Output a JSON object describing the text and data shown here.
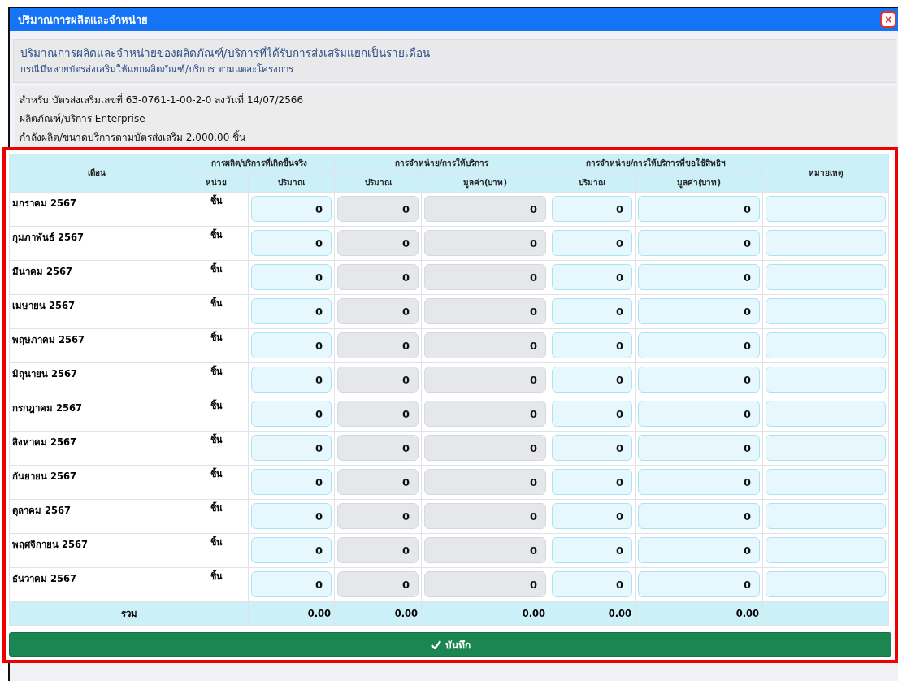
{
  "window": {
    "title": "ปริมาณการผลิตและจำหน่าย",
    "close": "×"
  },
  "intro": {
    "heading": "ปริมาณการผลิตและจำหน่ายของผลิตภัณฑ์/บริการที่ได้รับการส่งเสริมแยกเป็นรายเดือน",
    "note": "กรณีมีหลายบัตรส่งเสริมให้แยกผลิตภัณฑ์/บริการ ตามแต่ละโครงการ"
  },
  "info": [
    "สำหรับ บัตรส่งเสริมเลขที่ 63-0761-1-00-2-0 ลงวันที่ 14/07/2566",
    "ผลิตภัณฑ์/บริการ Enterprise",
    "กำลังผลิต/ขนาดบริการตามบัตรส่งเสริม 2,000.00 ชิ้น"
  ],
  "table": {
    "header_groups": [
      "เดือน",
      "การผลิต/บริการที่เกิดขึ้นจริง",
      "การจำหน่าย/การให้บริการ",
      "การจำหน่าย/การให้บริการที่ขอใช้สิทธิฯ",
      "หมายเหตุ"
    ],
    "sub_columns": [
      "หน่วย",
      "ปริมาณ",
      "ปริมาณ",
      "มูลค่า(บาท)",
      "ปริมาณ",
      "มูลค่า(บาท)"
    ],
    "input_columns": [
      {
        "disabled": false
      },
      {
        "disabled": true
      },
      {
        "disabled": true
      },
      {
        "disabled": false
      },
      {
        "disabled": false
      }
    ],
    "rows": [
      {
        "month": "มกราคม 2567",
        "unit": "ชิ้น",
        "values": [
          "0",
          "0",
          "0",
          "0",
          "0"
        ]
      },
      {
        "month": "กุมภาพันธ์ 2567",
        "unit": "ชิ้น",
        "values": [
          "0",
          "0",
          "0",
          "0",
          "0"
        ]
      },
      {
        "month": "มีนาคม 2567",
        "unit": "ชิ้น",
        "values": [
          "0",
          "0",
          "0",
          "0",
          "0"
        ]
      },
      {
        "month": "เมษายน 2567",
        "unit": "ชิ้น",
        "values": [
          "0",
          "0",
          "0",
          "0",
          "0"
        ]
      },
      {
        "month": "พฤษภาคม 2567",
        "unit": "ชิ้น",
        "values": [
          "0",
          "0",
          "0",
          "0",
          "0"
        ]
      },
      {
        "month": "มิถุนายน 2567",
        "unit": "ชิ้น",
        "values": [
          "0",
          "0",
          "0",
          "0",
          "0"
        ]
      },
      {
        "month": "กรกฎาคม 2567",
        "unit": "ชิ้น",
        "values": [
          "0",
          "0",
          "0",
          "0",
          "0"
        ]
      },
      {
        "month": "สิงหาคม 2567",
        "unit": "ชิ้น",
        "values": [
          "0",
          "0",
          "0",
          "0",
          "0"
        ]
      },
      {
        "month": "กันยายน 2567",
        "unit": "ชิ้น",
        "values": [
          "0",
          "0",
          "0",
          "0",
          "0"
        ]
      },
      {
        "month": "ตุลาคม 2567",
        "unit": "ชิ้น",
        "values": [
          "0",
          "0",
          "0",
          "0",
          "0"
        ]
      },
      {
        "month": "พฤศจิกายน 2567",
        "unit": "ชิ้น",
        "values": [
          "0",
          "0",
          "0",
          "0",
          "0"
        ]
      },
      {
        "month": "ธันวาคม 2567",
        "unit": "ชิ้น",
        "values": [
          "0",
          "0",
          "0",
          "0",
          "0"
        ]
      }
    ],
    "total": {
      "label": "รวม",
      "values": [
        "0.00",
        "0.00",
        "0.00",
        "0.00",
        "0.00"
      ]
    }
  },
  "save_button": "บันทึก"
}
